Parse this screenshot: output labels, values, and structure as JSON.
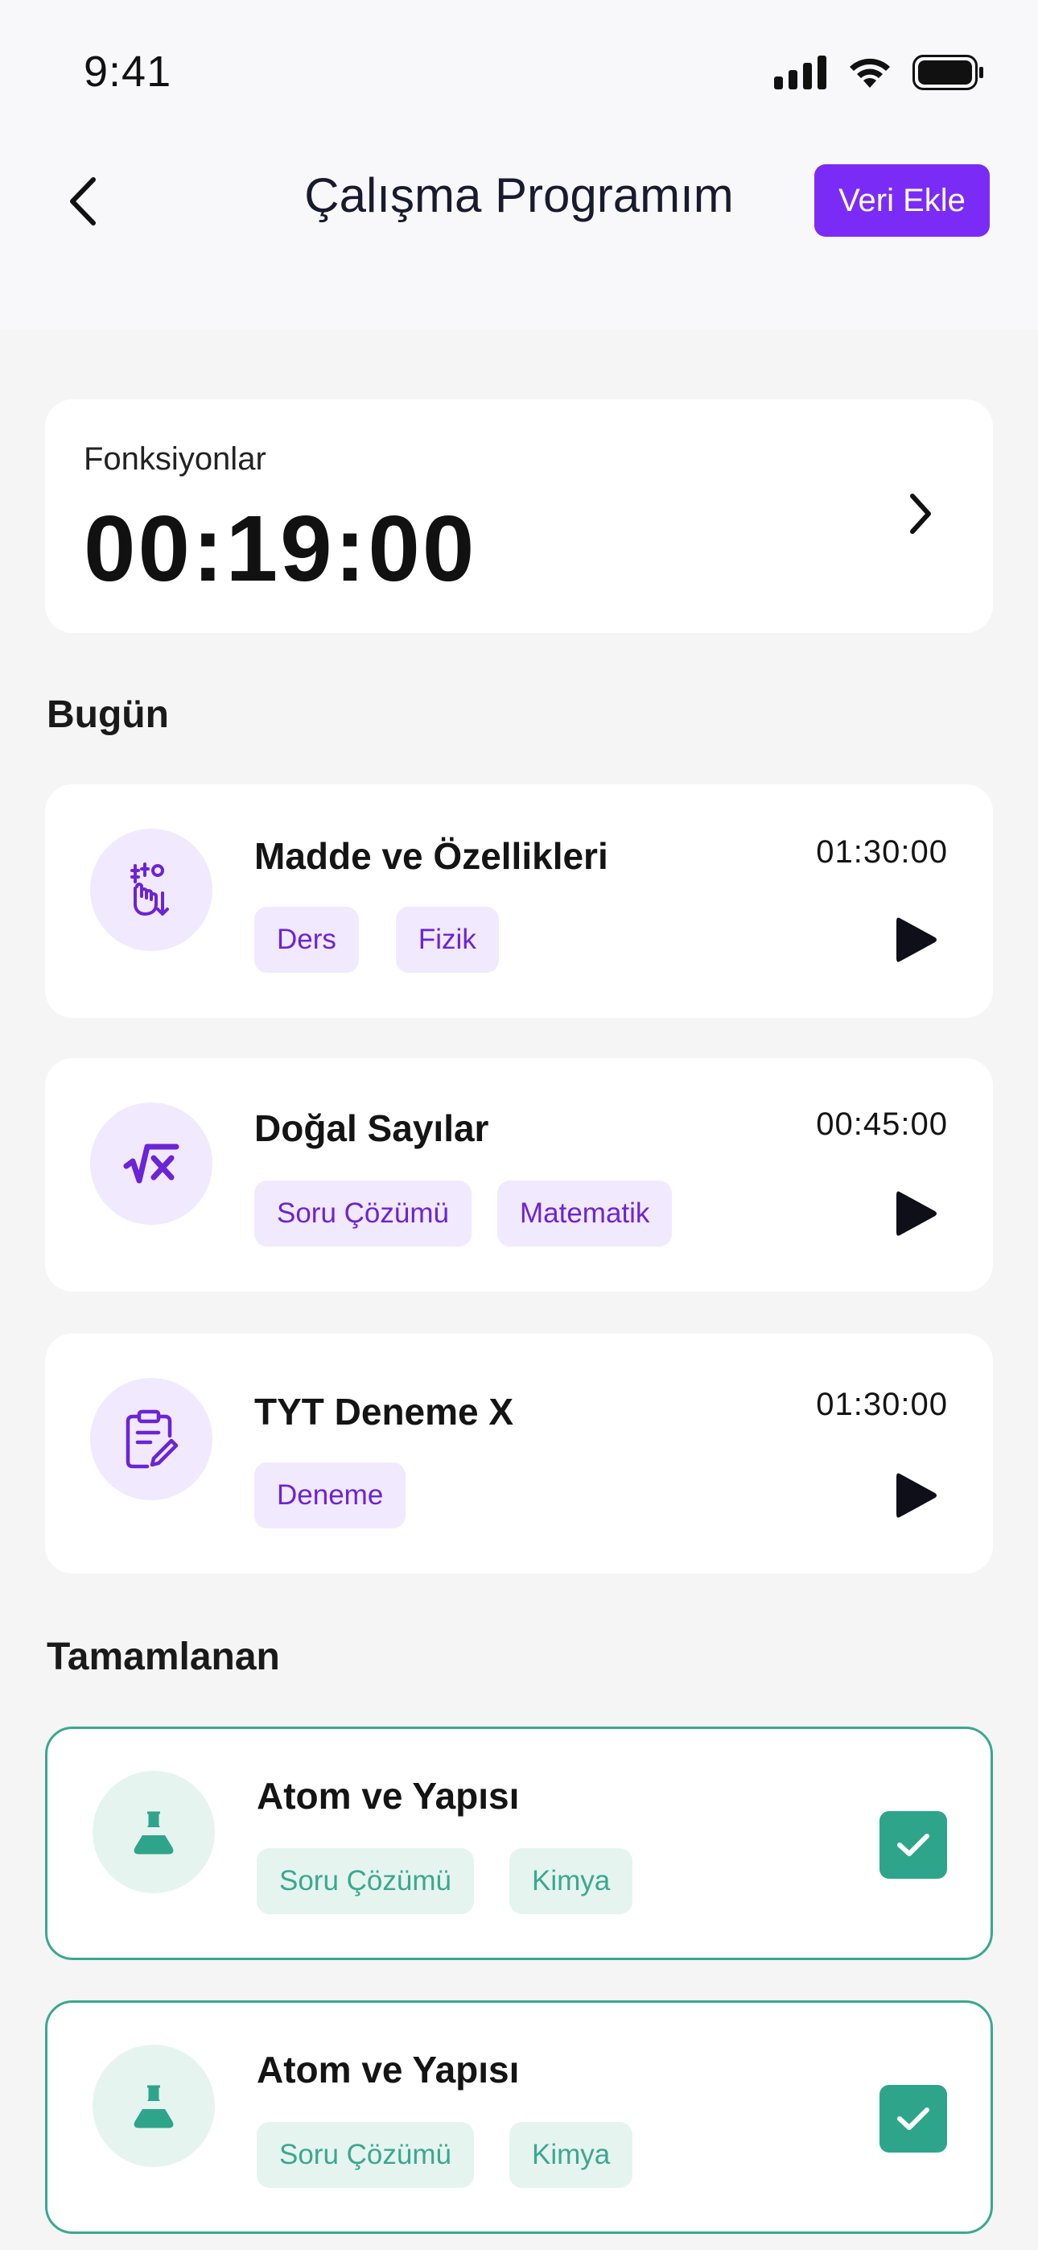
{
  "status_bar": {
    "time": "9:41"
  },
  "header": {
    "title": "Çalışma Programım",
    "add_button": "Veri Ekle"
  },
  "timer": {
    "label": "Fonksiyonlar",
    "value": "00:19:00"
  },
  "sections": {
    "today": "Bugün",
    "completed": "Tamamlanan"
  },
  "today_tasks": [
    {
      "title": "Madde ve Özellikleri",
      "time": "01:30:00",
      "tags": [
        "Ders",
        "Fizik"
      ],
      "icon": "physics-hand-icon"
    },
    {
      "title": "Doğal Sayılar",
      "time": "00:45:00",
      "tags": [
        "Soru Çözümü",
        "Matematik"
      ],
      "icon": "square-root-icon"
    },
    {
      "title": "TYT Deneme X",
      "time": "01:30:00",
      "tags": [
        "Deneme"
      ],
      "icon": "clipboard-edit-icon"
    }
  ],
  "completed_tasks": [
    {
      "title": "Atom ve Yapısı",
      "tags": [
        "Soru Çözümü",
        "Kimya"
      ],
      "icon": "flask-icon"
    },
    {
      "title": "Atom ve Yapısı",
      "tags": [
        "Soru Çözümü",
        "Kimya"
      ],
      "icon": "flask-icon"
    }
  ],
  "colors": {
    "accent": "#7a2cf6",
    "accent_light": "#f1e9fe",
    "success": "#2ea58a",
    "success_light": "#e6f4f0"
  }
}
